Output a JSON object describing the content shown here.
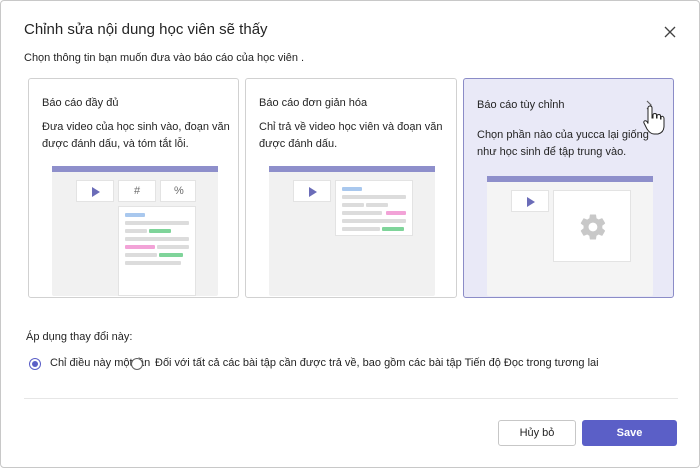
{
  "dialog": {
    "title": "Chỉnh sửa nội dung học viên sẽ thấy",
    "subtitle": "Chọn thông tin bạn muốn đưa vào báo cáo của học viên ."
  },
  "cards": [
    {
      "title": "Báo cáo đầy đủ",
      "description": "Đưa video của học sinh vào, đoạn văn được đánh dấu, và tóm tắt lỗi.",
      "symbols": [
        "#",
        "%"
      ]
    },
    {
      "title": "Báo cáo đơn giản hóa",
      "description": "Chỉ trả về video học viên và đoạn văn được đánh dấu."
    },
    {
      "title": "Báo cáo tùy chỉnh",
      "description": "Chọn phần nào của yucca lại giống như học sinh để tập trung vào."
    }
  ],
  "apply": {
    "label": "Áp dụng thay đổi này:",
    "options": [
      {
        "label": "Chỉ điều này một lần",
        "selected": true
      },
      {
        "label": "Đối với tất cả các bài tập cần được trả về, bao gồm các bài tập Tiến độ Đọc trong tương lai",
        "selected": false
      }
    ]
  },
  "buttons": {
    "cancel": "Hủy bỏ",
    "save": "Save"
  },
  "colors": {
    "accent": "#5b5fc7",
    "card_selected_bg": "#e9e9f7",
    "illus_bar": "#8e8fcb",
    "highlight_green": "#7fd49a",
    "highlight_pink": "#f2a3d7",
    "highlight_blue": "#a9c8ee"
  }
}
